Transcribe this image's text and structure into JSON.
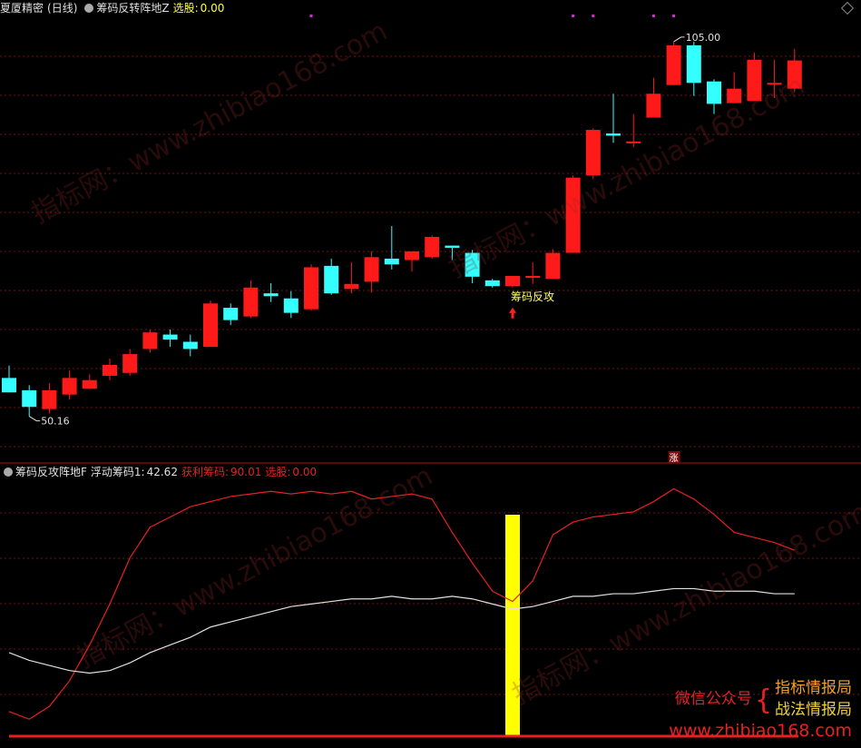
{
  "top_panel": {
    "title": "夏厦精密",
    "period": "(日线)",
    "indicator_name": "筹码反转阵地Z",
    "select_label": "选股:",
    "select_value": "0.00",
    "max_label": "105.00",
    "min_label": "50.16",
    "signal_label": "筹码反攻",
    "zhang_badge": "涨",
    "colors": {
      "up": "#ff1a1a",
      "down": "#33ffff",
      "grid": "#7a1010",
      "signal_text": "#ffff66"
    }
  },
  "bottom_panel": {
    "indicator_name": "筹码反攻阵地F",
    "float_label": "浮动筹码1:",
    "float_value": "42.62",
    "profit_label": "获利筹码:",
    "profit_value": "90.01",
    "select_label": "选股:",
    "select_value": "0.00",
    "colors": {
      "profit_line": "#e82020",
      "float_line": "#e0e0e0",
      "bar": "#ffff00"
    }
  },
  "watermark": "指标网：www.zhibiao168.com",
  "branding": {
    "wechat_label": "微信公众号",
    "line1": "指标情报局",
    "line2": "战法情报局",
    "url": "www.zhibiao168.com"
  },
  "chart_data": [
    {
      "type": "candlestick",
      "title": "夏厦精密",
      "ylim": [
        48,
        108
      ],
      "grid": true,
      "candles": [
        {
          "o": 58.5,
          "h": 60.2,
          "l": 56.5,
          "c": 56.5
        },
        {
          "o": 56.8,
          "h": 57.5,
          "l": 53.2,
          "c": 54.5
        },
        {
          "o": 54.2,
          "h": 57.8,
          "l": 53.6,
          "c": 56.8
        },
        {
          "o": 56.2,
          "h": 59.5,
          "l": 55.5,
          "c": 58.5
        },
        {
          "o": 57.0,
          "h": 59.0,
          "l": 57.0,
          "c": 58.2
        },
        {
          "o": 58.8,
          "h": 61.2,
          "l": 58.2,
          "c": 60.3
        },
        {
          "o": 59.2,
          "h": 62.5,
          "l": 58.8,
          "c": 61.8
        },
        {
          "o": 62.5,
          "h": 65.2,
          "l": 62.0,
          "c": 64.8
        },
        {
          "o": 64.5,
          "h": 65.2,
          "l": 62.8,
          "c": 63.8
        },
        {
          "o": 63.5,
          "h": 64.5,
          "l": 61.5,
          "c": 62.5
        },
        {
          "o": 62.8,
          "h": 69.2,
          "l": 62.8,
          "c": 68.8
        },
        {
          "o": 68.2,
          "h": 68.8,
          "l": 65.8,
          "c": 66.5
        },
        {
          "o": 67.0,
          "h": 72.0,
          "l": 66.8,
          "c": 71.0
        },
        {
          "o": 70.2,
          "h": 71.6,
          "l": 69.0,
          "c": 69.8
        },
        {
          "o": 69.5,
          "h": 70.5,
          "l": 66.8,
          "c": 67.5
        },
        {
          "o": 68.0,
          "h": 74.2,
          "l": 67.8,
          "c": 73.8
        },
        {
          "o": 74.0,
          "h": 75.0,
          "l": 70.0,
          "c": 70.2
        },
        {
          "o": 70.8,
          "h": 74.5,
          "l": 70.2,
          "c": 71.5
        },
        {
          "o": 71.8,
          "h": 76.0,
          "l": 70.3,
          "c": 75.2
        },
        {
          "o": 75.0,
          "h": 79.5,
          "l": 73.5,
          "c": 74.2
        },
        {
          "o": 74.8,
          "h": 76.0,
          "l": 73.2,
          "c": 76.0
        },
        {
          "o": 75.2,
          "h": 78.2,
          "l": 75.0,
          "c": 78.0
        },
        {
          "o": 76.8,
          "h": 76.8,
          "l": 74.8,
          "c": 76.5
        },
        {
          "o": 75.8,
          "h": 76.2,
          "l": 71.6,
          "c": 72.5
        },
        {
          "o": 72.0,
          "h": 72.2,
          "l": 71.0,
          "c": 71.2
        },
        {
          "o": 71.2,
          "h": 72.6,
          "l": 71.0,
          "c": 72.6
        },
        {
          "o": 72.4,
          "h": 74.5,
          "l": 71.5,
          "c": 72.6
        },
        {
          "o": 72.2,
          "h": 76.3,
          "l": 72.2,
          "c": 75.8
        },
        {
          "o": 75.8,
          "h": 86.5,
          "l": 75.8,
          "c": 86.2
        },
        {
          "o": 86.5,
          "h": 93.0,
          "l": 86.0,
          "c": 92.8
        },
        {
          "o": 92.3,
          "h": 97.8,
          "l": 91.0,
          "c": 92.0
        },
        {
          "o": 91.0,
          "h": 95.0,
          "l": 90.4,
          "c": 91.2
        },
        {
          "o": 94.5,
          "h": 100.0,
          "l": 94.5,
          "c": 97.8
        },
        {
          "o": 99.0,
          "h": 105.0,
          "l": 99.0,
          "c": 104.5
        },
        {
          "o": 104.5,
          "h": 105.0,
          "l": 97.5,
          "c": 99.3
        },
        {
          "o": 99.5,
          "h": 99.8,
          "l": 95.0,
          "c": 96.4
        },
        {
          "o": 96.5,
          "h": 100.8,
          "l": 96.5,
          "c": 98.5
        },
        {
          "o": 96.8,
          "h": 103.5,
          "l": 96.8,
          "c": 102.5
        },
        {
          "o": 99.3,
          "h": 102.5,
          "l": 97.2,
          "c": 99.3
        },
        {
          "o": 98.5,
          "h": 104.0,
          "l": 98.0,
          "c": 102.4
        }
      ],
      "signal_index": 25,
      "top_markers": [
        15,
        28,
        29,
        32,
        33
      ]
    },
    {
      "type": "line",
      "title": "筹码反攻阵地F",
      "ylim": [
        0,
        100
      ],
      "grid": true,
      "series": [
        {
          "name": "获利筹码",
          "values": [
            10,
            7,
            12,
            22,
            36,
            52,
            70,
            82,
            86,
            90,
            92,
            94,
            95,
            96,
            95,
            96,
            95,
            96,
            93,
            94,
            95,
            93,
            80,
            68,
            57,
            53,
            61,
            79,
            84,
            86,
            87,
            88,
            92,
            97,
            93,
            87,
            80,
            78,
            76,
            73
          ]
        },
        {
          "name": "浮动筹码1",
          "values": [
            33,
            30,
            28,
            26,
            25,
            26,
            29,
            33,
            36,
            39,
            43,
            45,
            47,
            49,
            51,
            52,
            53,
            54,
            54,
            55,
            54,
            54,
            55,
            54,
            52,
            50,
            51,
            53,
            55,
            55,
            56,
            56,
            57,
            58,
            58,
            57,
            57,
            57,
            56,
            56
          ]
        }
      ],
      "bar_index": 25,
      "bar_value": 100
    }
  ]
}
